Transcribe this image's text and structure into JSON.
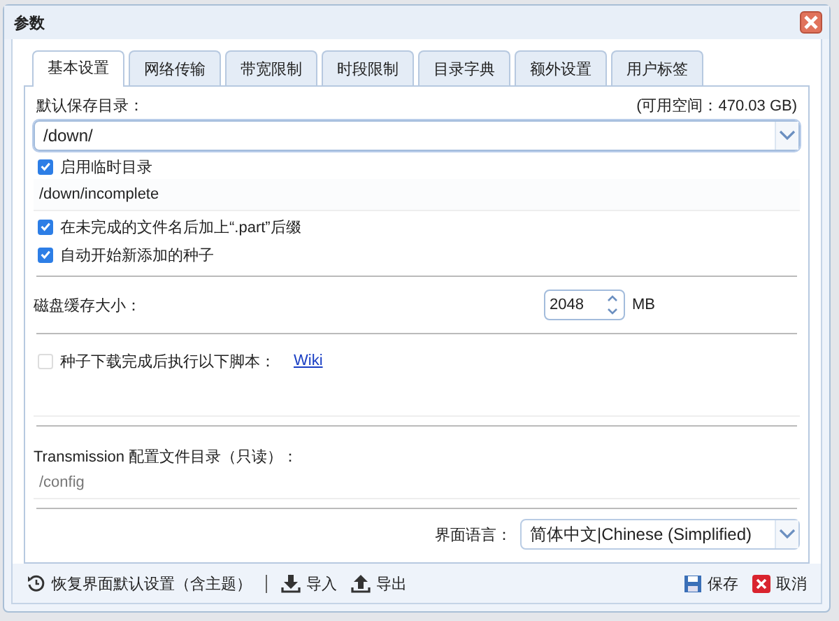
{
  "window": {
    "title": "参数"
  },
  "tabs": [
    {
      "label": "基本设置",
      "selected": true
    },
    {
      "label": "网络传输",
      "selected": false
    },
    {
      "label": "带宽限制",
      "selected": false
    },
    {
      "label": "时段限制",
      "selected": false
    },
    {
      "label": "目录字典",
      "selected": false
    },
    {
      "label": "额外设置",
      "selected": false
    },
    {
      "label": "用户标签",
      "selected": false
    }
  ],
  "download_dir": {
    "label": "默认保存目录：",
    "free_space": "(可用空间：470.03 GB)",
    "value": "/down/"
  },
  "incomplete": {
    "label": "启用临时目录",
    "checked": true,
    "value": "/down/incomplete"
  },
  "options": [
    {
      "label": "在未完成的文件名后加上“.part”后缀",
      "checked": true
    },
    {
      "label": "自动开始新添加的种子",
      "checked": true
    }
  ],
  "cache": {
    "label": "磁盘缓存大小：",
    "value": "2048",
    "unit": "MB"
  },
  "script": {
    "label": "种子下载完成后执行以下脚本：",
    "link": "Wiki",
    "checked": false
  },
  "config": {
    "label": "Transmission 配置文件目录（只读）：",
    "value": "/config"
  },
  "language": {
    "label": "界面语言：",
    "value": "简体中文|Chinese (Simplified)"
  },
  "footer": {
    "left": [
      {
        "kind": "reset",
        "label": "恢复界面默认设置（含主题）"
      },
      {
        "kind": "import",
        "label": "导入"
      },
      {
        "kind": "export",
        "label": "导出"
      }
    ],
    "right": [
      {
        "kind": "save",
        "label": "保存"
      },
      {
        "kind": "cancel",
        "label": "取消"
      }
    ]
  }
}
